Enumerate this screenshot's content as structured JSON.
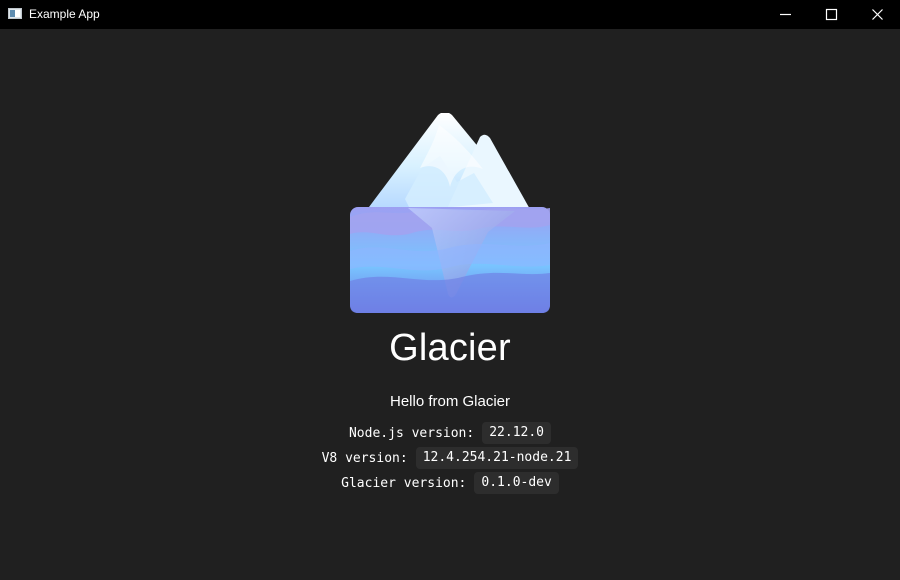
{
  "window": {
    "title": "Example App",
    "controls": {
      "minimize": "minimize-icon",
      "maximize": "maximize-icon",
      "close": "close-icon"
    }
  },
  "app": {
    "name": "Glacier",
    "greeting": "Hello from Glacier",
    "versions": [
      {
        "label": "Node.js version:",
        "value": "22.12.0"
      },
      {
        "label": "V8 version:",
        "value": "12.4.254.21-node.21"
      },
      {
        "label": "Glacier version:",
        "value": "0.1.0-dev"
      }
    ]
  },
  "colors": {
    "background": "#202020",
    "titlebar": "#000000",
    "text": "#ffffff",
    "codeBackground": "#2d2d2d",
    "logoBlue": "#7b8fe6"
  }
}
